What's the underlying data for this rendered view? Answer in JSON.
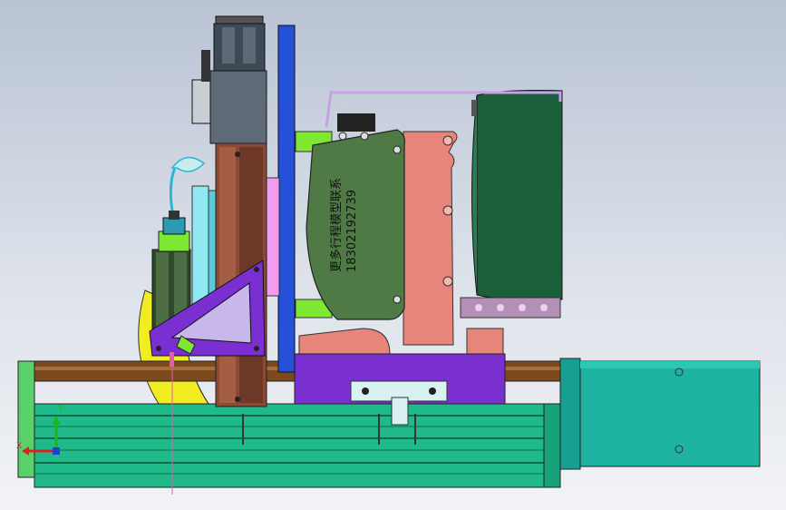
{
  "annotation": {
    "line1": "更多行程模型联系",
    "line2": "18302192739"
  },
  "triad": {
    "x_label": "X",
    "y_label": "Y"
  },
  "colors": {
    "background_top": "#b9c3d4",
    "background_bottom": "#f2f3f6",
    "rail_green": "#1fb98a",
    "motor_teal": "#1fb3a2",
    "carriage_purple": "#7a2fd0",
    "column_brown": "#8a4a36",
    "plate_blue": "#2550d8",
    "green_housing": "#4f7a45",
    "salmon_bracket": "#e7857a",
    "dark_green_drum": "#1b5e3a",
    "yellow_disc": "#f2ec22"
  }
}
